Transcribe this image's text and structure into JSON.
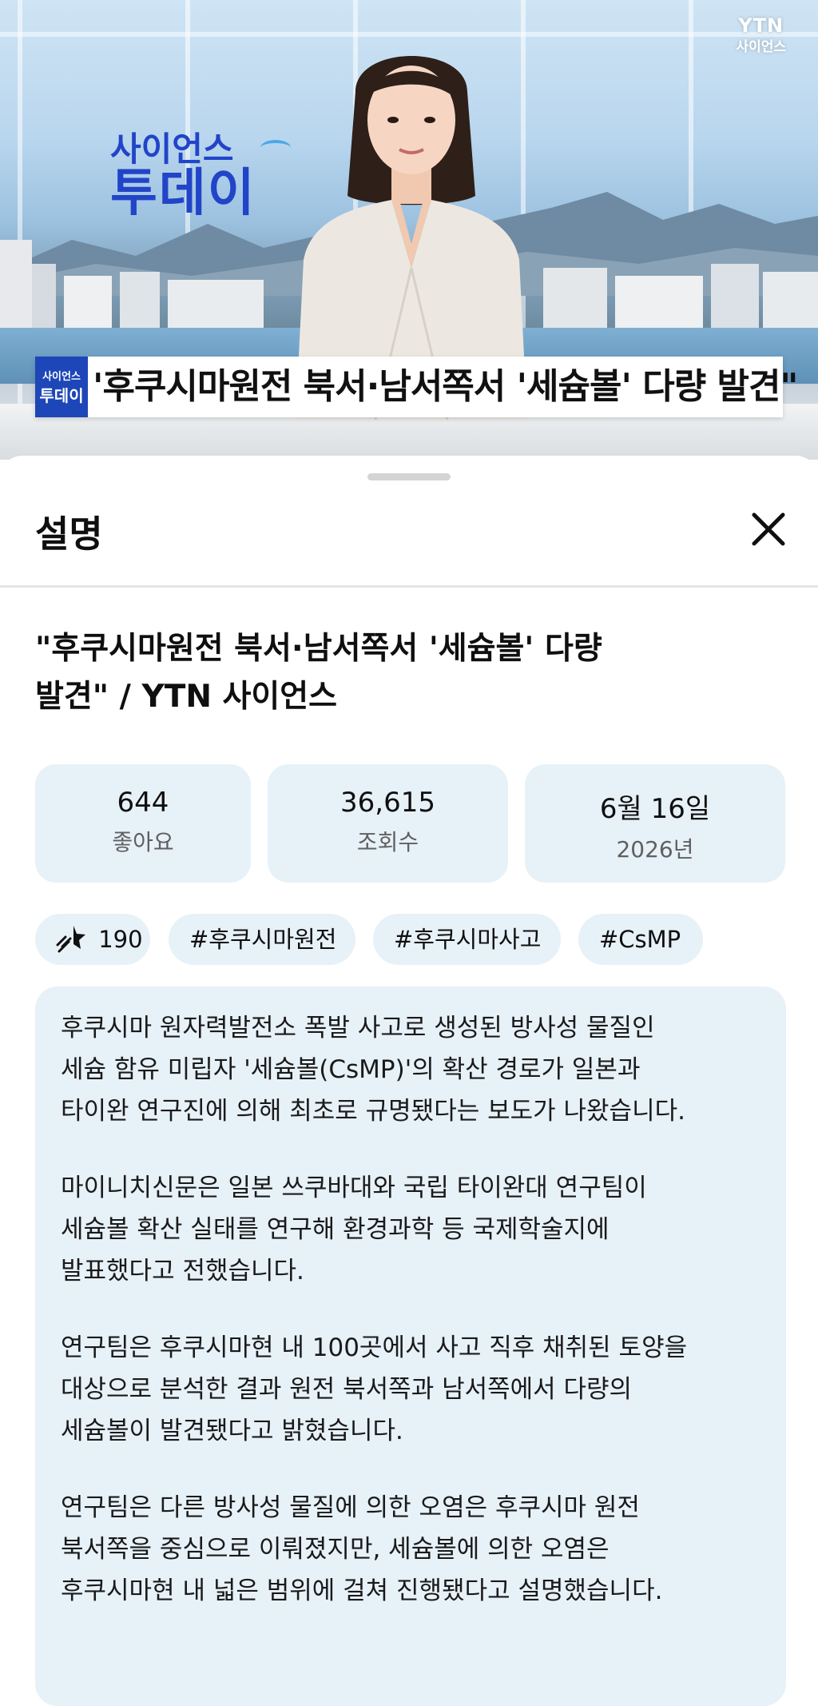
{
  "video": {
    "show_logo_line1": "사이언스",
    "show_logo_line2": "투데이",
    "channel_logo_top": "YTN",
    "channel_logo_bottom": "사이언스",
    "lower_third_badge_top": "사이언스",
    "lower_third_badge_bottom": "투데이",
    "lower_third_text": "'후쿠시마원전 북서·남서쪽서 '세슘볼' 다량 발견\""
  },
  "sheet": {
    "title": "설명",
    "close_icon": "close-icon",
    "video_title_line1": "\"후쿠시마원전 북서·남서쪽서 '세슘볼' 다량",
    "video_title_line2": "발견\" / YTN 사이언스",
    "stats": [
      {
        "value": "644",
        "label": "좋아요"
      },
      {
        "value": "36,615",
        "label": "조회수"
      },
      {
        "value": "6월 16일",
        "label": "2026년"
      }
    ],
    "chips": {
      "thanks_icon": "super-thanks-icon",
      "thanks_count": "190",
      "hashtags": [
        "#후쿠시마원전",
        "#후쿠시마사고",
        "#CsMP"
      ]
    },
    "description": [
      [
        "후쿠시마 원자력발전소 폭발 사고로 생성된 방사성 물질인",
        "세슘 함유 미립자 '세슘볼(CsMP)'의 확산 경로가 일본과",
        "타이완 연구진에 의해 최초로 규명됐다는 보도가 나왔습니다."
      ],
      [
        "마이니치신문은 일본 쓰쿠바대와 국립 타이완대 연구팀이",
        "세슘볼 확산 실태를 연구해 환경과학 등 국제학술지에",
        "발표했다고 전했습니다."
      ],
      [
        "연구팀은 후쿠시마현 내 100곳에서 사고 직후 채취된 토양을",
        "대상으로 분석한 결과 원전 북서쪽과 남서쪽에서 다량의",
        "세슘볼이 발견됐다고 밝혔습니다."
      ],
      [
        "연구팀은 다른 방사성 물질에 의한 오염은 후쿠시마 원전",
        "북서쪽을 중심으로 이뤄졌지만, 세슘볼에 의한 오염은",
        "후쿠시마현 내 넓은 범위에 걸쳐 진행됐다고 설명했습니다."
      ]
    ]
  }
}
